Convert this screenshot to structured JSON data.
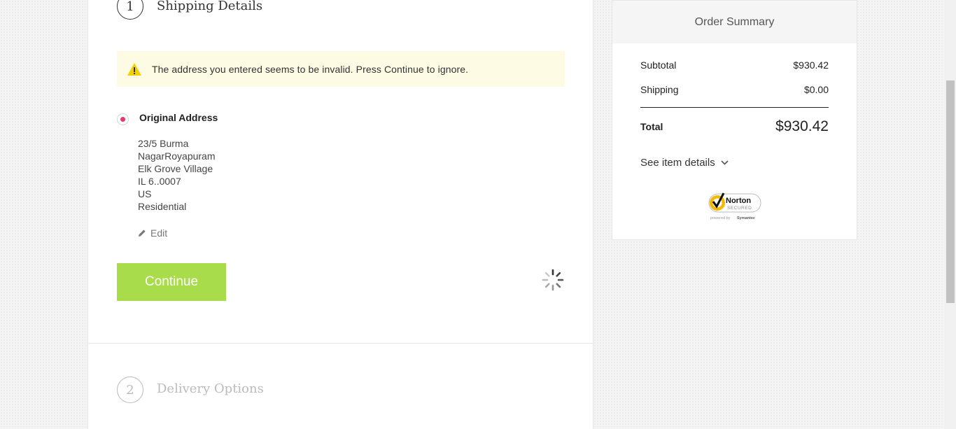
{
  "steps": [
    {
      "number": "1",
      "title": "Shipping Details"
    },
    {
      "number": "2",
      "title": "Delivery Options"
    }
  ],
  "warning": {
    "text": "The address you entered seems to be invalid. Press Continue to ignore."
  },
  "address": {
    "label": "Original Address",
    "lines": [
      "23/5 Burma",
      "NagarRoyapuram",
      "Elk Grove Village",
      "IL 6..0007",
      "US",
      "Residential"
    ],
    "edit_label": "Edit"
  },
  "continue_label": "Continue",
  "summary": {
    "title": "Order Summary",
    "subtotal_label": "Subtotal",
    "subtotal_value": "$930.42",
    "shipping_label": "Shipping",
    "shipping_value": "$0.00",
    "total_label": "Total",
    "total_value": "$930.42",
    "details_label": "See item details"
  },
  "norton": {
    "brand": "Norton",
    "secured": "SECURED",
    "powered": "powered by",
    "symantec": "Symantec"
  },
  "colors": {
    "accent": "#a8dc4a",
    "radio": "#e6396a",
    "warning_bg": "#fefbe5",
    "warning_icon": "#f5d000"
  }
}
